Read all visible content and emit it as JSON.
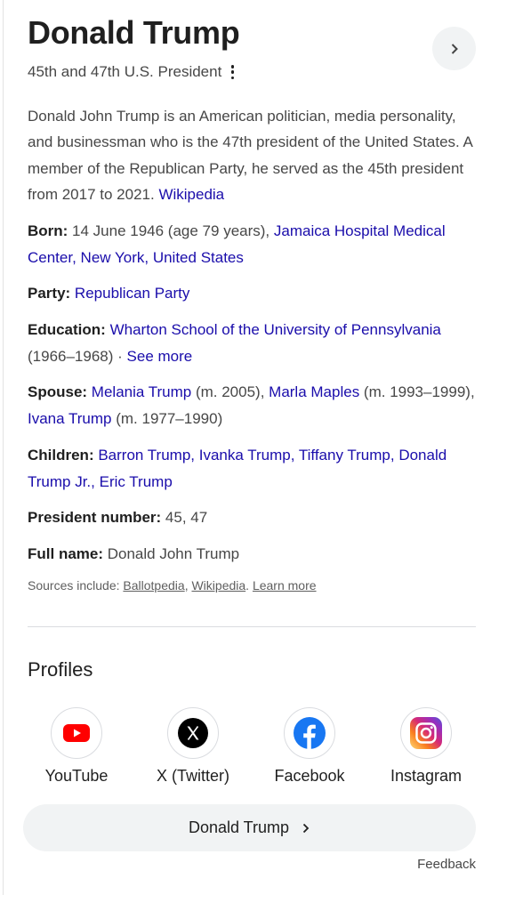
{
  "panel": {
    "title": "Donald Trump",
    "subtitle": "45th and 47th U.S. President",
    "more_icon": "more-vert-icon",
    "expand_icon": "chevron-right-icon"
  },
  "description": {
    "text": "Donald John Trump is an American politician, media personality, and businessman who is the 47th president of the United States. A member of the Republican Party, he served as the 45th president from 2017 to 2021. ",
    "source_link": "Wikipedia"
  },
  "facts": {
    "born": {
      "label": "Born:",
      "text": " 14 June 1946 (age 79 years), ",
      "link1": "Jamaica Hospital Medical Center",
      "sep1": ", ",
      "link2": "New York",
      "sep2": ", ",
      "link3": "United States"
    },
    "party": {
      "label": "Party:",
      "link": "Republican Party"
    },
    "education": {
      "label": "Education:",
      "link": "Wharton School of the University of Pennsylvania",
      "text": " (1966–1968) · ",
      "see_more": "See more"
    },
    "spouse": {
      "label": "Spouse:",
      "link1": "Melania Trump",
      "text1": " (m. 2005), ",
      "link2": "Marla Maples",
      "text2": " (m. 1993–1999), ",
      "link3": "Ivana Trump",
      "text3": " (m. 1977–1990)"
    },
    "children": {
      "label": "Children:",
      "items": [
        "Barron Trump",
        "Ivanka Trump",
        "Tiffany Trump",
        "Donald Trump Jr.",
        "Eric Trump"
      ],
      "separator": ", "
    },
    "president_number": {
      "label": "President number:",
      "value": " 45, 47"
    },
    "full_name": {
      "label": "Full name:",
      "value": " Donald John Trump"
    }
  },
  "sources": {
    "prefix": "Sources include: ",
    "link1": "Ballotpedia",
    "sep": ", ",
    "link2": "Wikipedia",
    "sep2": ". ",
    "learn_more": "Learn more"
  },
  "profiles": {
    "title": "Profiles",
    "items": [
      {
        "label": "YouTube",
        "icon": "youtube-icon",
        "color": "#ff0000"
      },
      {
        "label": "X (Twitter)",
        "icon": "x-twitter-icon",
        "color": "#000000"
      },
      {
        "label": "Facebook",
        "icon": "facebook-icon",
        "color": "#1877f2"
      },
      {
        "label": "Instagram",
        "icon": "instagram-icon",
        "color": "#d62976"
      }
    ]
  },
  "more_button": {
    "label": "Donald Trump",
    "icon": "chevron-right-icon"
  },
  "feedback": "Feedback",
  "colors": {
    "link": "#1a0dab",
    "text": "#1f1f1f",
    "secondary_text": "#474747",
    "button_bg": "#f1f3f4"
  }
}
